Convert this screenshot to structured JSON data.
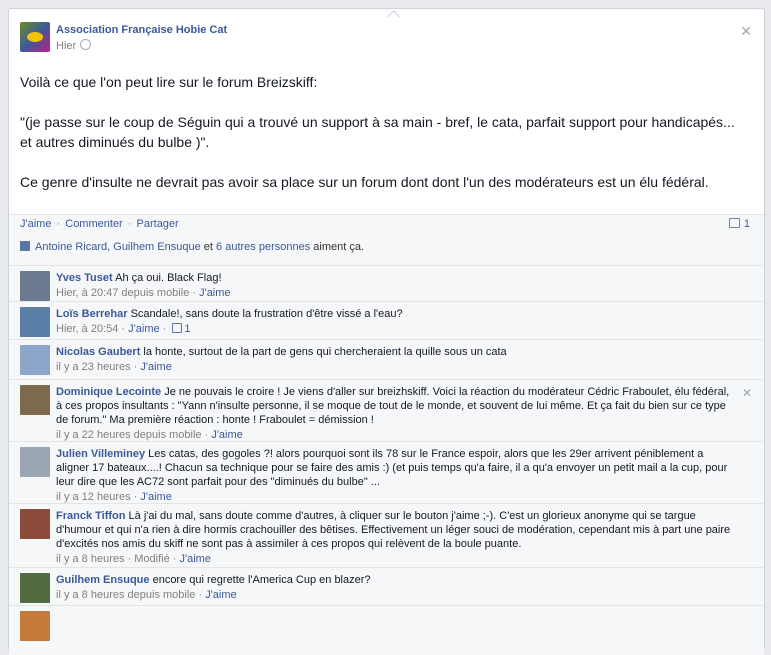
{
  "post": {
    "page_name": "Association Française Hobie Cat",
    "timestamp": "Hier",
    "paragraphs": [
      "Voilà ce que l'on peut lire sur le forum Breizskiff:",
      "\"(je passe sur le coup de Séguin qui a trouvé un support à sa main - bref, le cata, parfait support pour handicapés... et autres diminués du bulbe )\".",
      "Ce genre d'insulte ne devrait pas avoir sa place sur un forum dont dont l'un des modérateurs est un élu fédéral."
    ]
  },
  "actions": {
    "like": "J'aime",
    "comment": "Commenter",
    "share": "Partager",
    "separator": "·",
    "comment_count": "1"
  },
  "likes": {
    "names": "Antoine Ricard, Guilhem Ensuque",
    "connector": "et",
    "others": "6 autres personnes",
    "suffix": "aiment ça."
  },
  "comments": [
    {
      "author": "Yves Tuset",
      "text": "Ah ça oui. Black Flag!",
      "meta": "Hier, à 20:47 depuis mobile",
      "like": "J'aime",
      "avatar_color": "#6b7a8f"
    },
    {
      "author": "Loïs Berrehar",
      "text": "Scandale!, sans doute la frustration d'être vissé a l'eau?",
      "meta": "Hier, à 20:54",
      "like": "J'aime",
      "like_count": "1",
      "avatar_color": "#5a7fa6"
    },
    {
      "author": "Nicolas Gaubert",
      "text": "la honte, surtout de la part de gens qui chercheraient la quille sous un cata",
      "meta": "il y a 23 heures",
      "like": "J'aime",
      "avatar_color": "#8ba6c9"
    },
    {
      "author": "Dominique Lecointe",
      "text": "Je ne pouvais le croire ! Je viens d'aller sur breizhskiff. Voici la réaction du modérateur Cédric Fraboulet, élu fédéral, à ces propos insultants : \"Yann n'insulte personne, il se moque de tout de le monde, et souvent de lui même. Et ça fait du bien sur ce type de forum.\" Ma première réaction : honte ! Fraboulet = démission !",
      "meta": "il y a 22 heures depuis mobile",
      "like": "J'aime",
      "avatar_color": "#7d6a4e"
    },
    {
      "author": "Julien Villeminey",
      "text": "Les catas, des gogoles ?! alors pourquoi sont ils 78 sur le France espoir, alors que les 29er arrivent péniblement a aligner 17 bateaux....! Chacun sa technique pour se faire des amis :) (et puis temps qu'a faire, il a qu'a envoyer un petit mail a la cup, pour leur dire que les AC72 sont parfait pour des \"diminués du bulbe\" ...",
      "meta": "il y a 12 heures",
      "like": "J'aime",
      "avatar_color": "#9aa7b3"
    },
    {
      "author": "Franck Tiffon",
      "text": "Là j'ai du mal, sans doute comme d'autres, à cliquer sur le bouton j'aime ;-). C'est un glorieux anonyme qui se targue d'humour et qui n'a rien à dire hormis crachouiller des bêtises. Effectivement un léger souci de modération, cependant mis à part une paire d'excités nos amis du skiff ne sont pas à assimiler à ces propos qui relèvent de la boule puante.",
      "meta": "il y a 8 heures",
      "modified": "Modifié",
      "like": "J'aime",
      "avatar_color": "#8a4b3a"
    },
    {
      "author": "Guilhem Ensuque",
      "text": "encore qui regrette l'America Cup en blazer?",
      "meta": "il y a 8 heures depuis mobile",
      "like": "J'aime",
      "avatar_color": "#4f6b3f"
    }
  ]
}
